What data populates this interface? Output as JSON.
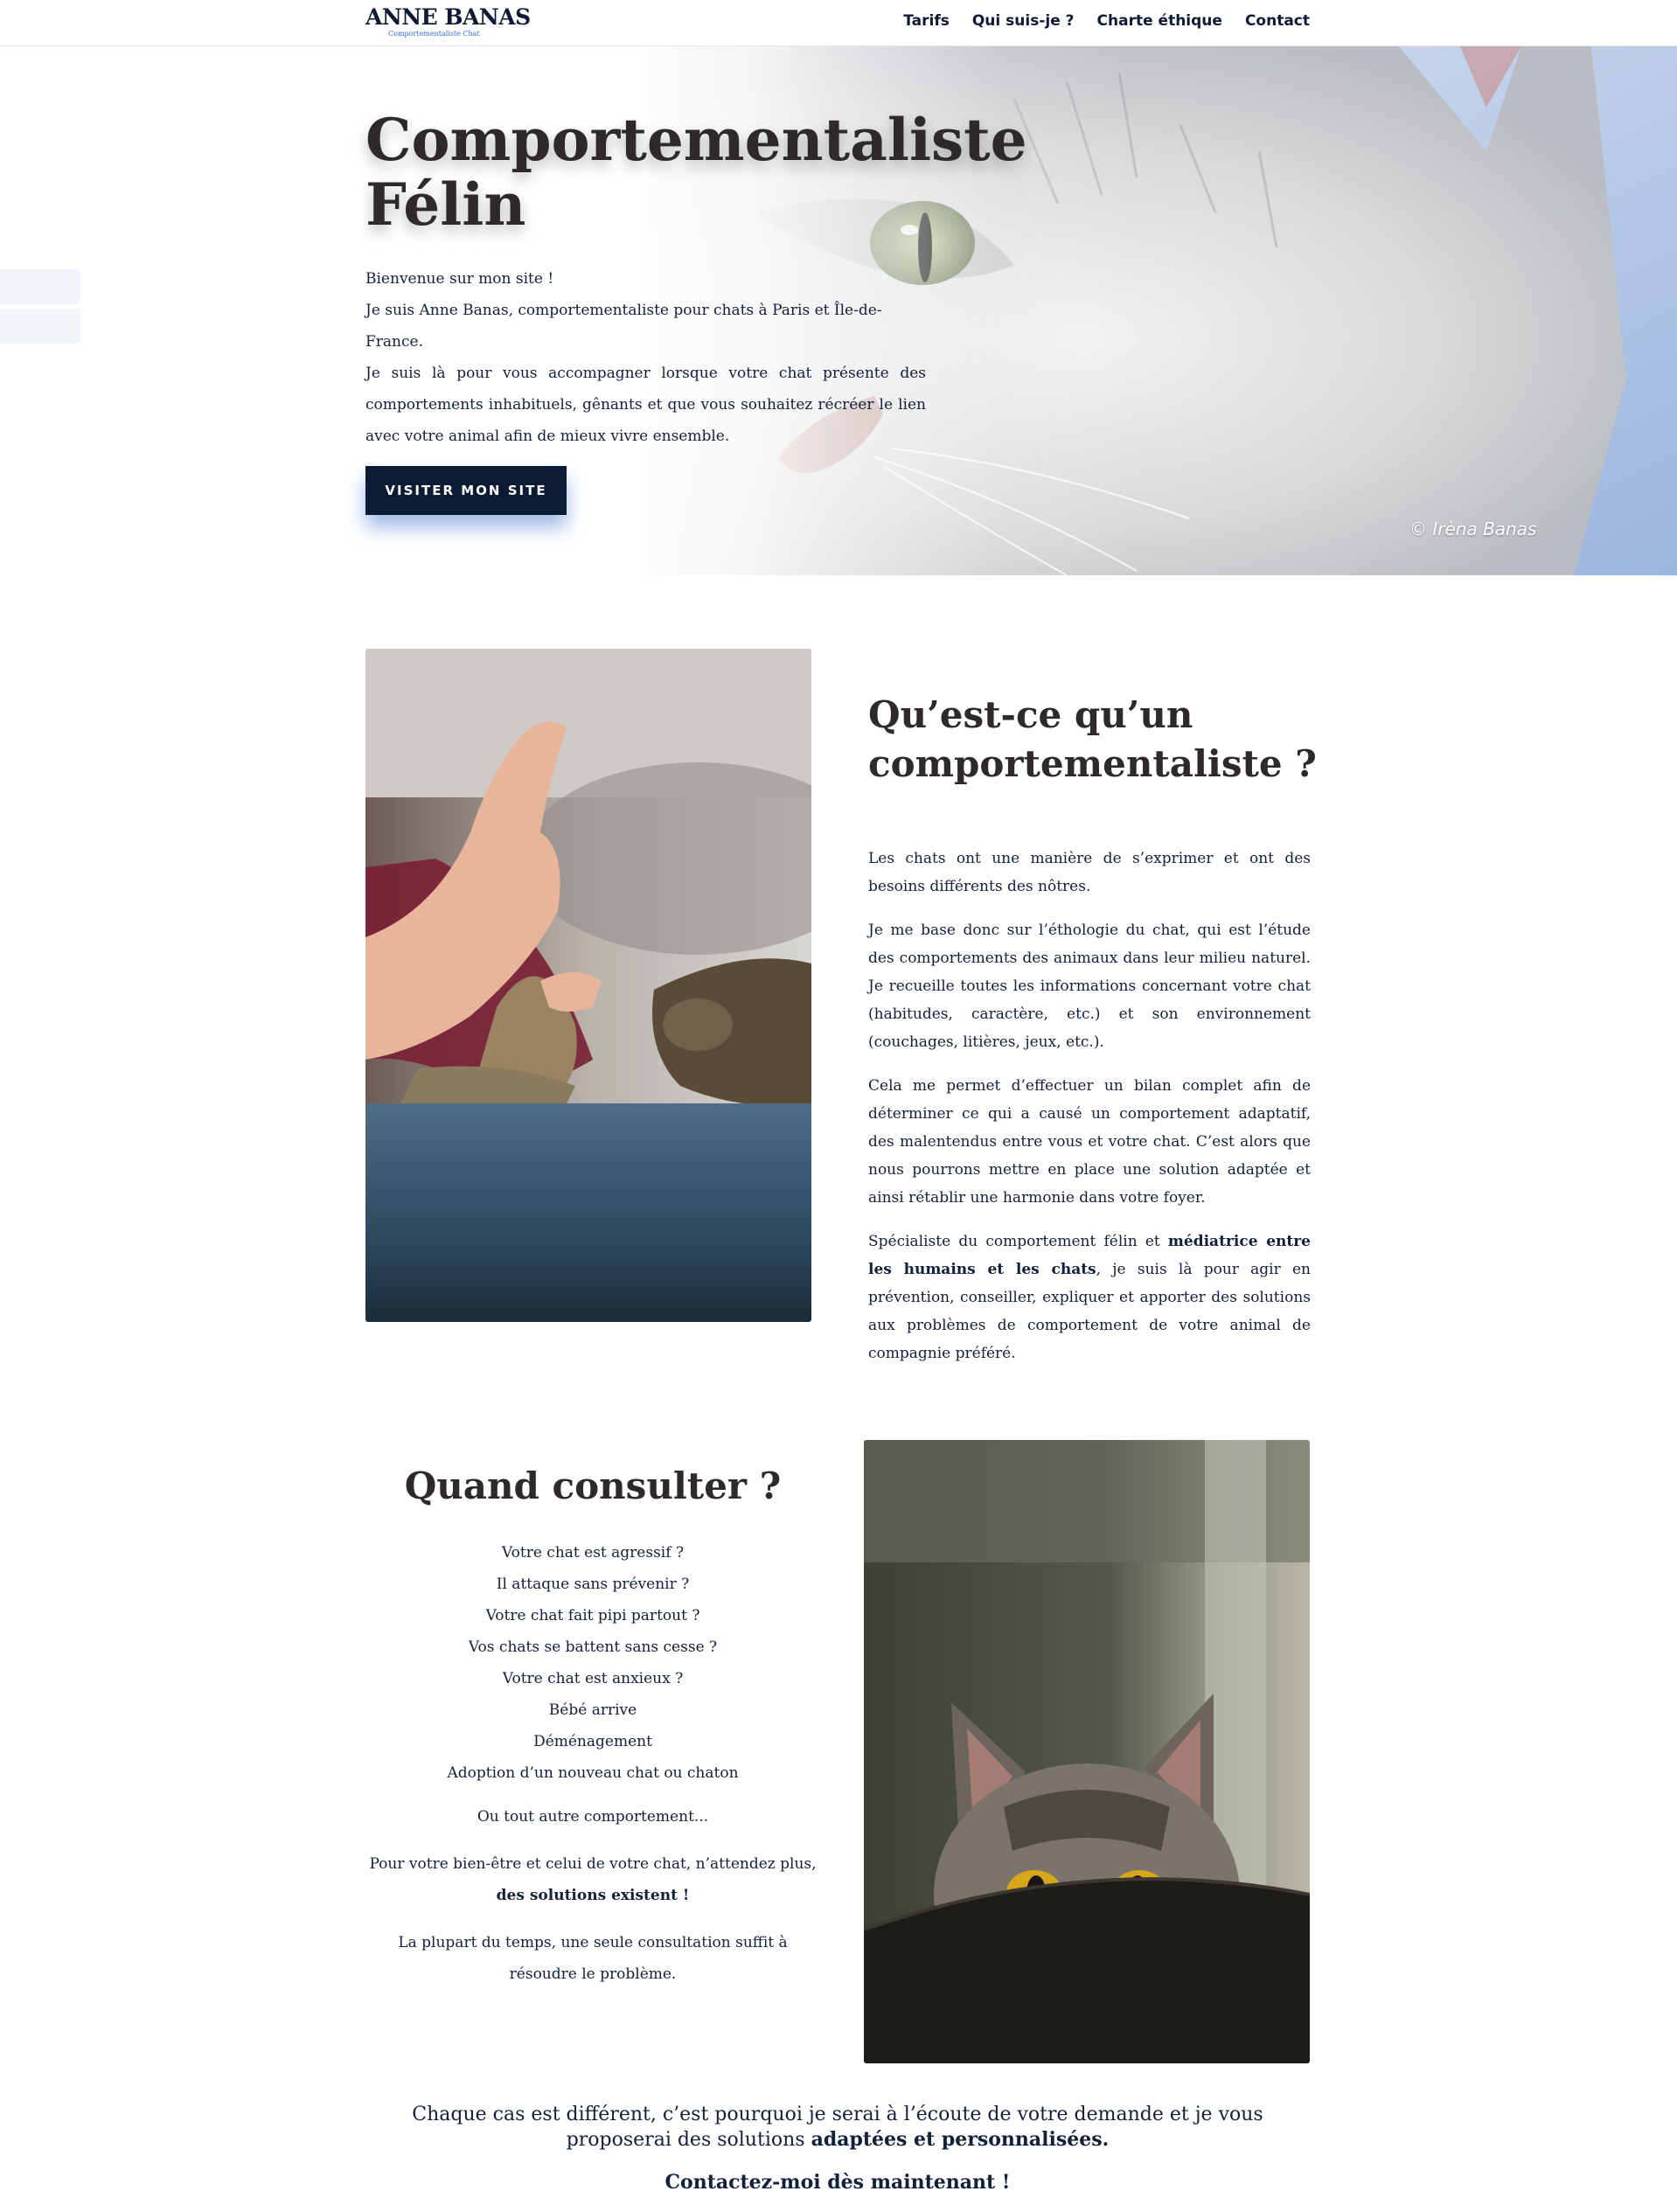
{
  "header": {
    "logo_name": "ANNE BANAS",
    "logo_tagline": "Comportementaliste Chat",
    "nav": [
      "Tarifs",
      "Qui suis-je ?",
      "Charte éthique",
      "Contact"
    ]
  },
  "hero": {
    "title": "Comportementaliste Félin",
    "lines": [
      "Bienvenue sur mon site !",
      "Je suis Anne Banas, comportementaliste pour chats à Paris et Île-de-France.",
      "Je suis là pour vous accompagner lorsque votre chat présente des comportements inhabituels, gênants et que vous souhaitez récréer le lien avec votre animal afin de mieux vivre ensemble."
    ],
    "button_label": "VISITER MON SITE",
    "photo_credit": "© Irèna Banas"
  },
  "about": {
    "title": "Qu’est-ce qu’un comportementaliste ?",
    "paragraphs": [
      "Les chats ont une manière de s’exprimer et ont des besoins différents des nôtres.",
      "Je me base donc sur l’éthologie du chat, qui est l’étude des comportements des animaux dans leur milieu naturel. Je recueille toutes les informations concernant votre chat (habitudes, caractère, etc.) et son environnement (couchages, litières, jeux, etc.).",
      "Cela me permet d’effectuer un bilan complet afin de déterminer ce qui a causé un comportement adaptatif, des malentendus entre vous et votre chat. C’est alors que nous pourrons mettre en place une solution adaptée et ainsi rétablir une harmonie dans votre foyer."
    ],
    "last_paragraph": {
      "before": "Spécialiste du comportement félin et ",
      "bold": "médiatrice entre les humains et les chats",
      "after": ", je suis là pour agir en prévention, conseiller, expliquer et apporter des solutions aux problèmes de comportement de votre animal de compagnie préféré."
    }
  },
  "consult": {
    "title": "Quand consulter ?",
    "items": [
      "Votre chat est agressif ?",
      "Il attaque sans prévenir  ?",
      "Votre chat fait pipi partout ?",
      "Vos chats se battent sans cesse ?",
      "Votre chat est anxieux ?",
      "Bébé arrive",
      "Déménagement",
      "Adoption d’un nouveau chat ou chaton"
    ],
    "other": "Ou tout autre comportement...",
    "wait_line": "Pour votre bien-être et celui de votre chat, n’attendez plus,",
    "wait_bold": "des solutions existent !",
    "single_consult": "La plupart du temps, une seule consultation suffit à résoudre le problème."
  },
  "closing": {
    "text": "Chaque cas est différent, c’est pourquoi je serai à l’écoute de votre demande et je vous proposerai des solutions ",
    "bold": "adaptées et personnalisées.",
    "cta": "Contactez-moi dès maintenant !"
  }
}
